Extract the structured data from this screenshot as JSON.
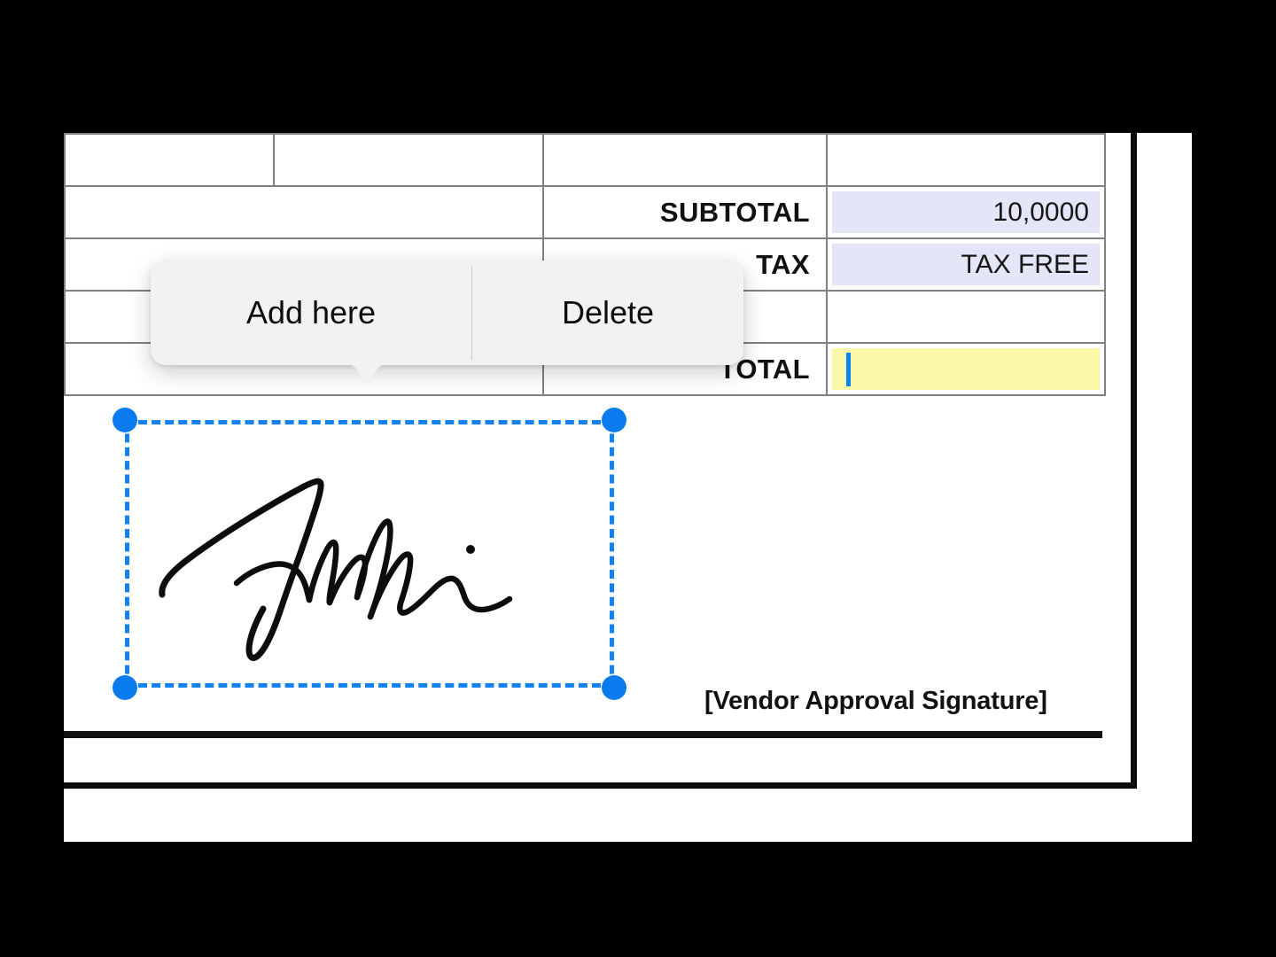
{
  "app": {
    "background_color": "#000000",
    "page_color": "#ffffff"
  },
  "document": {
    "border_color": "#0a0a0a",
    "table_border_color": "#808080"
  },
  "table": {
    "columns": [
      "",
      "",
      "",
      ""
    ],
    "rows": [
      {
        "type": "header",
        "label": "",
        "value": ""
      },
      {
        "type": "total_line",
        "label": "SUBTOTAL",
        "value": "10,0000",
        "fill": "#e5e5f8"
      },
      {
        "type": "total_line",
        "label": "TAX",
        "value": "TAX FREE",
        "fill": "#e5e5f8"
      },
      {
        "type": "spacer",
        "label": "",
        "value": ""
      },
      {
        "type": "total_line",
        "label": "TOTAL",
        "value": "",
        "fill": "#fbf7a8",
        "editing": true
      }
    ],
    "labels": {
      "subtotal": "SUBTOTAL",
      "tax": "TAX",
      "total": "TOTAL"
    },
    "values": {
      "subtotal": "10,0000",
      "tax": "TAX FREE",
      "total": ""
    },
    "caret_color": "#0b84f3"
  },
  "signature_field": {
    "label": "[Vendor Approval Signature]",
    "selected": true,
    "selection_color": "#1282f0",
    "handle_color": "#0a7cf0",
    "handle_count": 4,
    "ink_color": "#0d0d0d"
  },
  "context_menu": {
    "visible": true,
    "background": "#f2f2f2",
    "items": [
      {
        "label": "Add here",
        "name": "add-here"
      },
      {
        "label": "Delete",
        "name": "delete"
      }
    ],
    "add_label": "Add here",
    "delete_label": "Delete"
  }
}
